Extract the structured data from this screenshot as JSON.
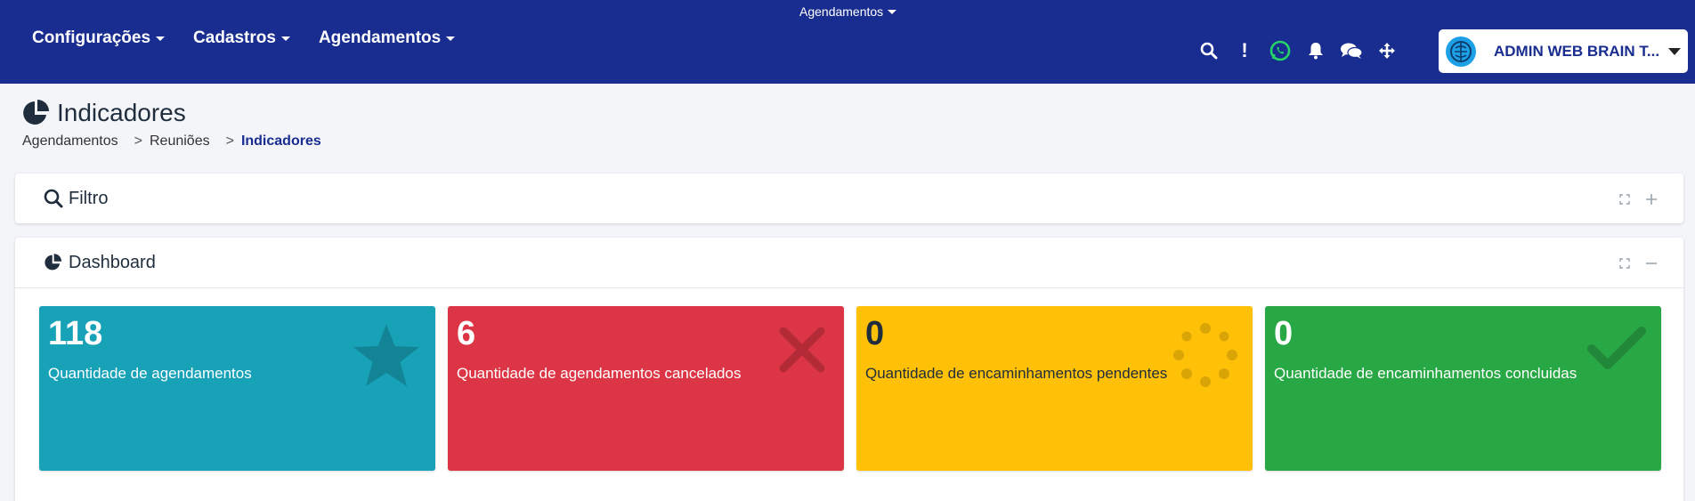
{
  "header": {
    "top_dropdown": "Agendamentos",
    "menu": [
      {
        "label": "Configurações"
      },
      {
        "label": "Cadastros"
      },
      {
        "label": "Agendamentos"
      }
    ],
    "icons": [
      "search-icon",
      "exclamation-icon",
      "whatsapp-icon",
      "bell-icon",
      "chat-icon",
      "arrows-move-icon"
    ],
    "exclamation": "!",
    "user_name": "ADMIN WEB BRAIN T..."
  },
  "page": {
    "title": "Indicadores",
    "breadcrumb": [
      {
        "label": "Agendamentos"
      },
      {
        "label": "Reuniões"
      },
      {
        "label": "Indicadores"
      }
    ],
    "breadcrumb_sep": ">"
  },
  "filter_card": {
    "title": "Filtro"
  },
  "dashboard_card": {
    "title": "Dashboard"
  },
  "stats": [
    {
      "value": "118",
      "label": "Quantidade de agendamentos",
      "color": "#17a2b8",
      "icon": "star-icon"
    },
    {
      "value": "6",
      "label": "Quantidade de agendamentos cancelados",
      "color": "#dc3545",
      "icon": "times-icon"
    },
    {
      "value": "0",
      "label": "Quantidade de encaminhamentos pendentes",
      "color": "#ffc107",
      "icon": "spinner-icon"
    },
    {
      "value": "0",
      "label": "Quantidade de encaminhamentos concluidas",
      "color": "#28a745",
      "icon": "check-icon"
    }
  ],
  "colors": {
    "navbar": "#182d8f",
    "accent": "#182d8f",
    "background": "#f3f5f9"
  }
}
